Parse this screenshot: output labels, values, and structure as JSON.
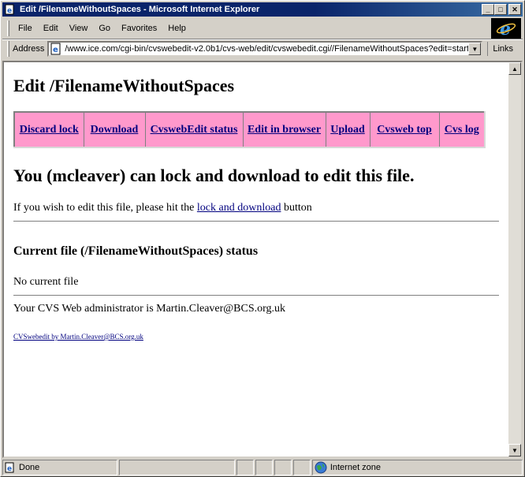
{
  "window": {
    "title": "Edit /FilenameWithoutSpaces - Microsoft Internet Explorer",
    "minimize_glyph": "_",
    "maximize_glyph": "□",
    "close_glyph": "✕"
  },
  "menu": [
    {
      "label": "File"
    },
    {
      "label": "Edit"
    },
    {
      "label": "View"
    },
    {
      "label": "Go"
    },
    {
      "label": "Favorites"
    },
    {
      "label": "Help"
    }
  ],
  "address": {
    "label": "Address",
    "url": "/www.ice.com/cgi-bin/cvswebedit-v2.0b1/cvs-web/edit/cvswebedit.cgi//FilenameWithoutSpaces?edit=start",
    "links_label": "Links"
  },
  "page": {
    "title": "Edit /FilenameWithoutSpaces",
    "nav": [
      {
        "label": "Discard lock"
      },
      {
        "label": "Download"
      },
      {
        "label": "CvswebEdit status"
      },
      {
        "label": "Edit in browser"
      },
      {
        "label": "Upload"
      },
      {
        "label": "Cvsweb top"
      },
      {
        "label": "Cvs log"
      }
    ],
    "lock_message": "You (mcleaver) can lock and download to edit this file.",
    "instruction_prefix": "If you wish to edit this file, please hit the",
    "instruction_link": "lock and download",
    "instruction_suffix": "button",
    "status_heading": "Current file (/FilenameWithoutSpaces) status",
    "no_current_file": "No current file",
    "admin_text": "Your CVS Web administrator is Martin.Cleaver@BCS.org.uk",
    "footer_link": "CVSwebedit by Martin.Cleaver@BCS.org.uk"
  },
  "status": {
    "text": "Done",
    "zone": "Internet zone"
  }
}
